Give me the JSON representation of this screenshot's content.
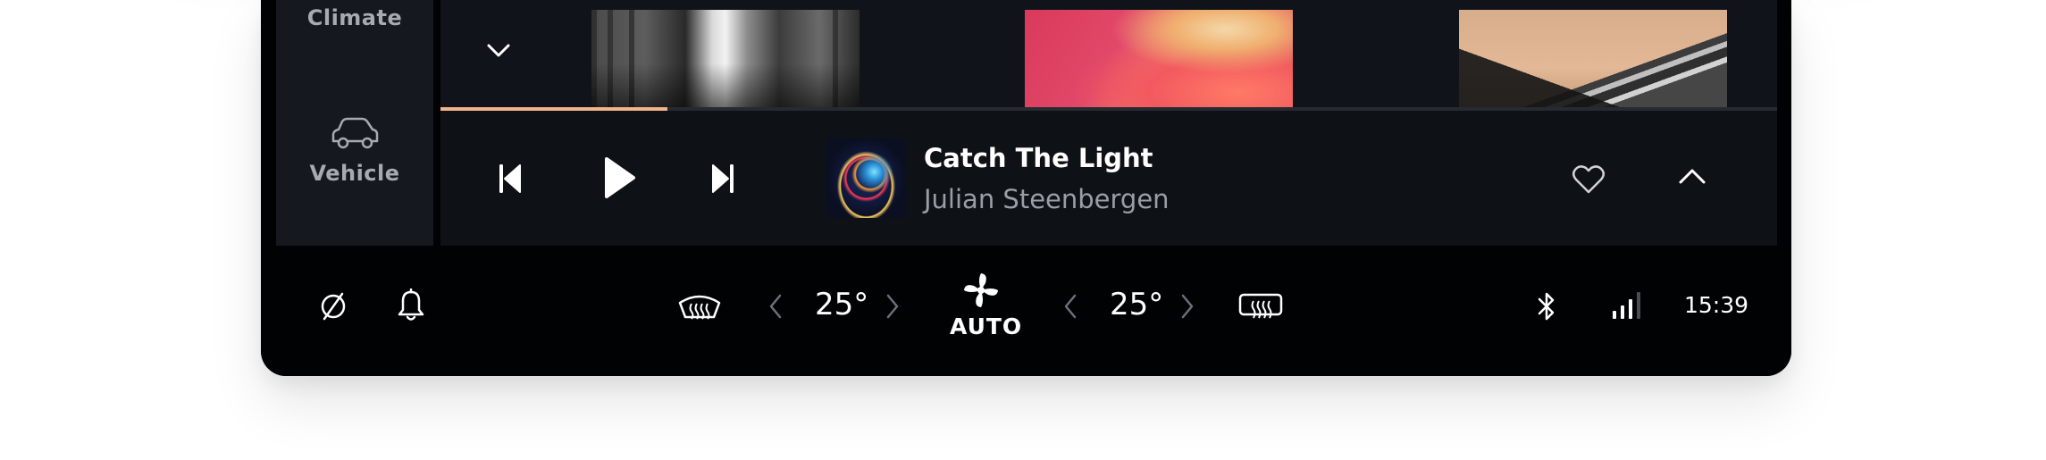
{
  "sidebar": {
    "items": [
      {
        "label": "Climate",
        "icon": "climate-icon"
      },
      {
        "label": "Vehicle",
        "icon": "car-icon"
      }
    ]
  },
  "media": {
    "progress": 0.17,
    "track_title": "Catch The Light",
    "artist": "Julian Steenbergen",
    "accent_color": "#f2b48b",
    "controls": [
      "chevron-down-icon",
      "previous-icon",
      "play-icon",
      "next-icon",
      "heart-icon",
      "chevron-up-icon"
    ]
  },
  "climate": {
    "left_temp": "25°",
    "right_temp": "25°",
    "fan_mode": "AUTO"
  },
  "status": {
    "time": "15:39",
    "icons": [
      "no-entry-icon",
      "bell-icon",
      "front-defrost-icon",
      "fan-icon",
      "rear-defrost-icon",
      "bluetooth-icon",
      "signal-icon"
    ]
  }
}
